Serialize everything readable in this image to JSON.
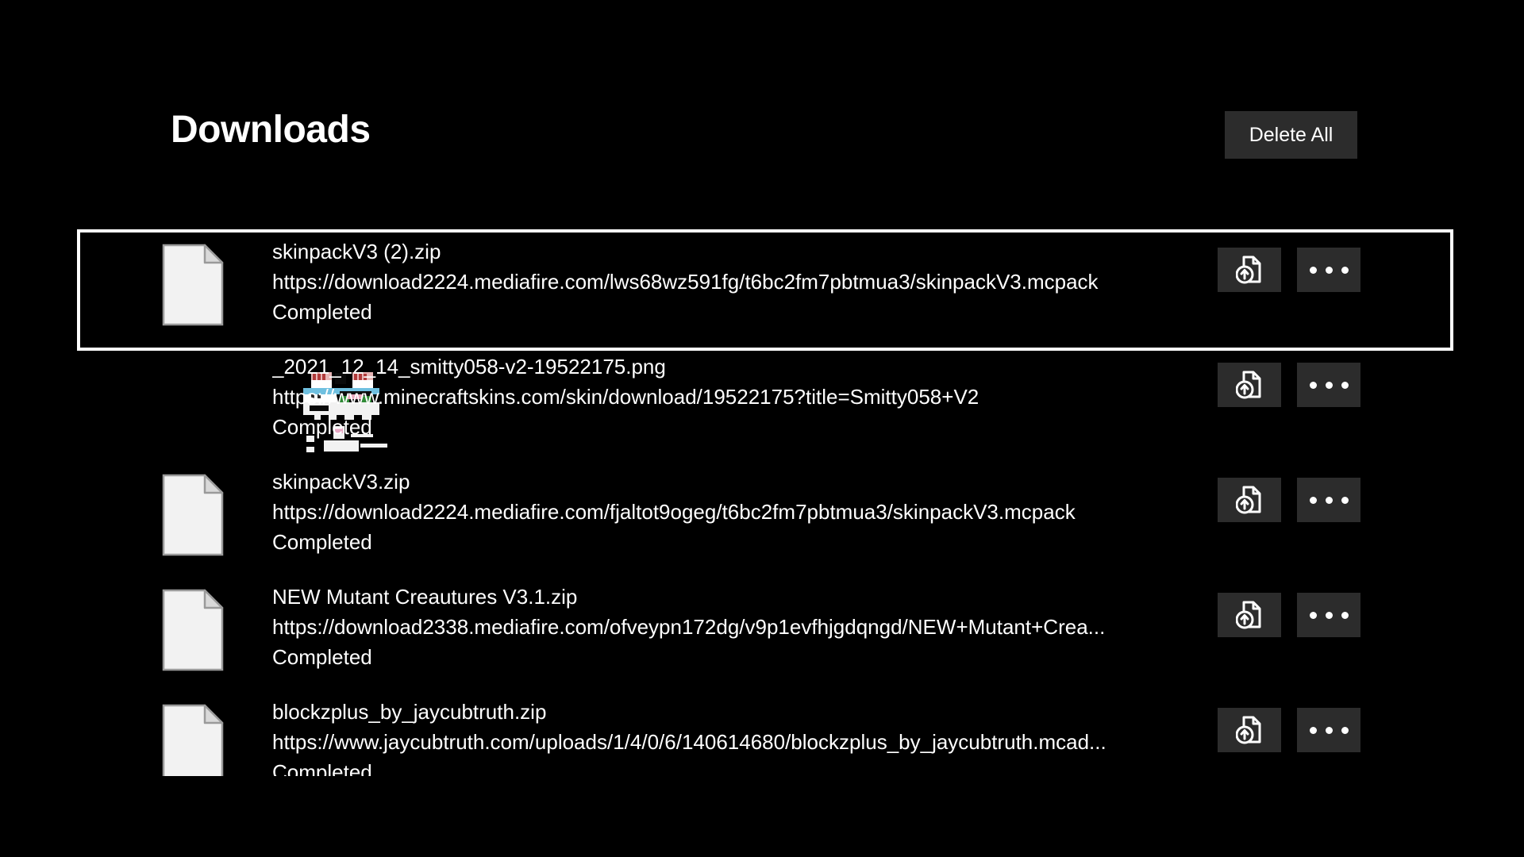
{
  "header": {
    "title": "Downloads",
    "delete_all_label": "Delete All"
  },
  "colors": {
    "background": "#000000",
    "button_bg": "#2c2c2c",
    "text": "#ffffff",
    "selection_border": "#ffffff"
  },
  "actions": {
    "open_file_icon": "file-upload-icon",
    "more_options_icon": "ellipsis-icon"
  },
  "downloads": [
    {
      "file_name": "skinpackV3 (2).zip",
      "url": "https://download2224.mediafire.com/lws68wz591fg/t6bc2fm7pbtmua3/skinpackV3.mcpack",
      "status": "Completed",
      "thumbnail": "document-icon",
      "selected": true
    },
    {
      "file_name": "_2021_12_14_smitty058-v2-19522175.png",
      "url": "https://www.minecraftskins.com/skin/download/19522175?title=Smitty058+V2",
      "status": "Completed",
      "thumbnail": "skin-image-preview",
      "selected": false
    },
    {
      "file_name": "skinpackV3.zip",
      "url": "https://download2224.mediafire.com/fjaltot9ogeg/t6bc2fm7pbtmua3/skinpackV3.mcpack",
      "status": "Completed",
      "thumbnail": "document-icon",
      "selected": false
    },
    {
      "file_name": "NEW Mutant Creautures V3.1.zip",
      "url": "https://download2338.mediafire.com/ofveypn172dg/v9p1evfhjgdqngd/NEW+Mutant+Crea...",
      "status": "Completed",
      "thumbnail": "document-icon",
      "selected": false
    },
    {
      "file_name": "blockzplus_by_jaycubtruth.zip",
      "url": "https://www.jaycubtruth.com/uploads/1/4/0/6/140614680/blockzplus_by_jaycubtruth.mcad...",
      "status": "Completed",
      "thumbnail": "document-icon",
      "selected": false
    }
  ]
}
